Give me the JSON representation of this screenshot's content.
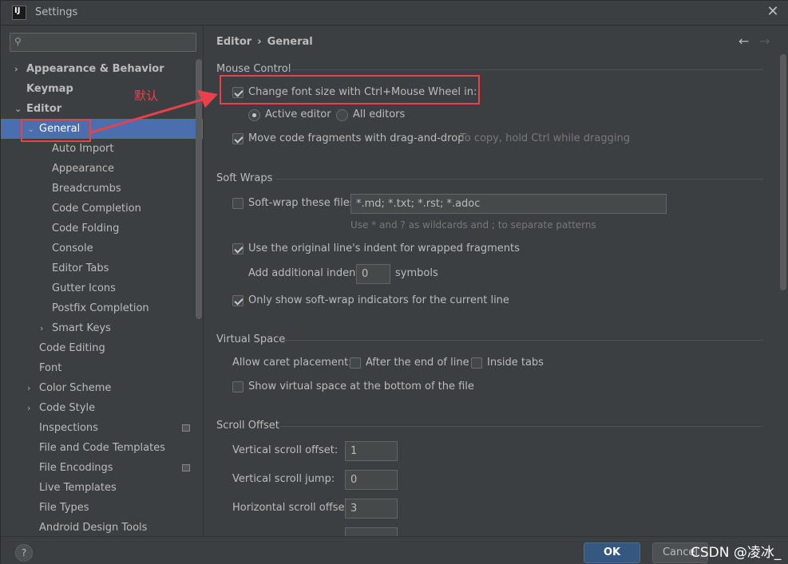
{
  "window": {
    "title": "Settings"
  },
  "search": {
    "placeholder": ""
  },
  "tree": [
    {
      "label": "Appearance & Behavior",
      "bold": true,
      "arrow": "›",
      "level": 0
    },
    {
      "label": "Keymap",
      "bold": true,
      "arrow": "",
      "level": 0
    },
    {
      "label": "Editor",
      "bold": true,
      "arrow": "⌄",
      "level": 0
    },
    {
      "label": "General",
      "bold": false,
      "arrow": "⌄",
      "level": 1,
      "selected": true
    },
    {
      "label": "Auto Import",
      "level": 2
    },
    {
      "label": "Appearance",
      "level": 2
    },
    {
      "label": "Breadcrumbs",
      "level": 2
    },
    {
      "label": "Code Completion",
      "level": 2
    },
    {
      "label": "Code Folding",
      "level": 2
    },
    {
      "label": "Console",
      "level": 2
    },
    {
      "label": "Editor Tabs",
      "level": 2
    },
    {
      "label": "Gutter Icons",
      "level": 2
    },
    {
      "label": "Postfix Completion",
      "level": 2
    },
    {
      "label": "Smart Keys",
      "arrow": "›",
      "level": 2
    },
    {
      "label": "Code Editing",
      "level": 1
    },
    {
      "label": "Font",
      "level": 1
    },
    {
      "label": "Color Scheme",
      "arrow": "›",
      "level": 1
    },
    {
      "label": "Code Style",
      "arrow": "›",
      "level": 1
    },
    {
      "label": "Inspections",
      "level": 1,
      "badge": true
    },
    {
      "label": "File and Code Templates",
      "level": 1
    },
    {
      "label": "File Encodings",
      "level": 1,
      "badge": true
    },
    {
      "label": "Live Templates",
      "level": 1
    },
    {
      "label": "File Types",
      "level": 1
    },
    {
      "label": "Android Design Tools",
      "level": 1
    }
  ],
  "breadcrumb": {
    "parent": "Editor",
    "sep": "›",
    "current": "General"
  },
  "sections": {
    "mouse": {
      "title": "Mouse Control",
      "change_font": "Change font size with Ctrl+Mouse Wheel in:",
      "active_editor": "Active editor",
      "all_editors": "All editors",
      "move_code": "Move code fragments with drag-and-drop",
      "move_hint": "To copy, hold Ctrl while dragging"
    },
    "soft": {
      "title": "Soft Wraps",
      "wrap_files": "Soft-wrap these files:",
      "wrap_value": "*.md; *.txt; *.rst; *.adoc",
      "wrap_hint": "Use * and ? as wildcards and ; to separate patterns",
      "original_indent": "Use the original line's indent for wrapped fragments",
      "add_indent": "Add additional indent:",
      "indent_value": "0",
      "symbols": "symbols",
      "only_show": "Only show soft-wrap indicators for the current line"
    },
    "virtual": {
      "title": "Virtual Space",
      "allow_caret": "Allow caret placement:",
      "after_end": "After the end of line",
      "inside_tabs": "Inside tabs",
      "show_virtual": "Show virtual space at the bottom of the file"
    },
    "scroll": {
      "title": "Scroll Offset",
      "vertical_offset": "Vertical scroll offset:",
      "vertical_offset_value": "1",
      "vertical_jump": "Vertical scroll jump:",
      "vertical_jump_value": "0",
      "horizontal_offset": "Horizontal scroll offset:",
      "horizontal_offset_value": "3"
    }
  },
  "footer": {
    "help": "?",
    "ok": "OK",
    "cancel": "Cancel"
  },
  "annotation": {
    "text": "默认"
  },
  "watermark": "CSDN @凌冰_"
}
